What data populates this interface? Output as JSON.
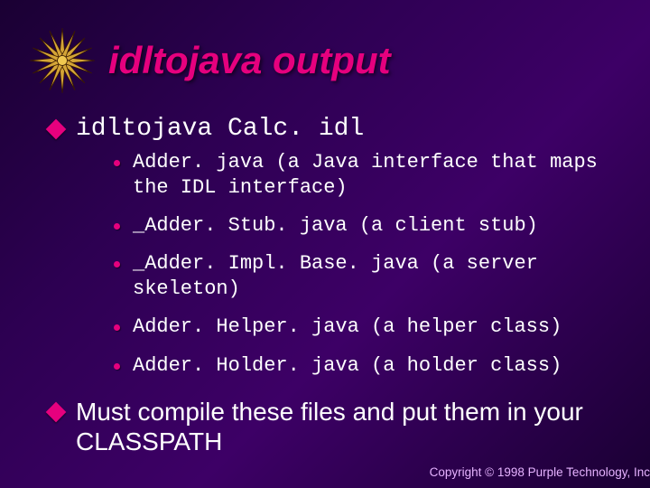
{
  "title": "idltojava output",
  "bullets": {
    "command": "idltojava Calc. idl",
    "files": [
      "Adder. java (a Java interface that maps the IDL interface)",
      "_Adder. Stub. java (a client stub)",
      "_Adder. Impl. Base. java (a server skeleton)",
      "Adder. Helper. java (a helper class)",
      "Adder. Holder. java (a holder class)"
    ],
    "closing_prefix": "Must",
    "closing_rest": " compile these files and put them in your CLASSPATH"
  },
  "copyright": "Copyright © 1998 Purple Technology, Inc"
}
